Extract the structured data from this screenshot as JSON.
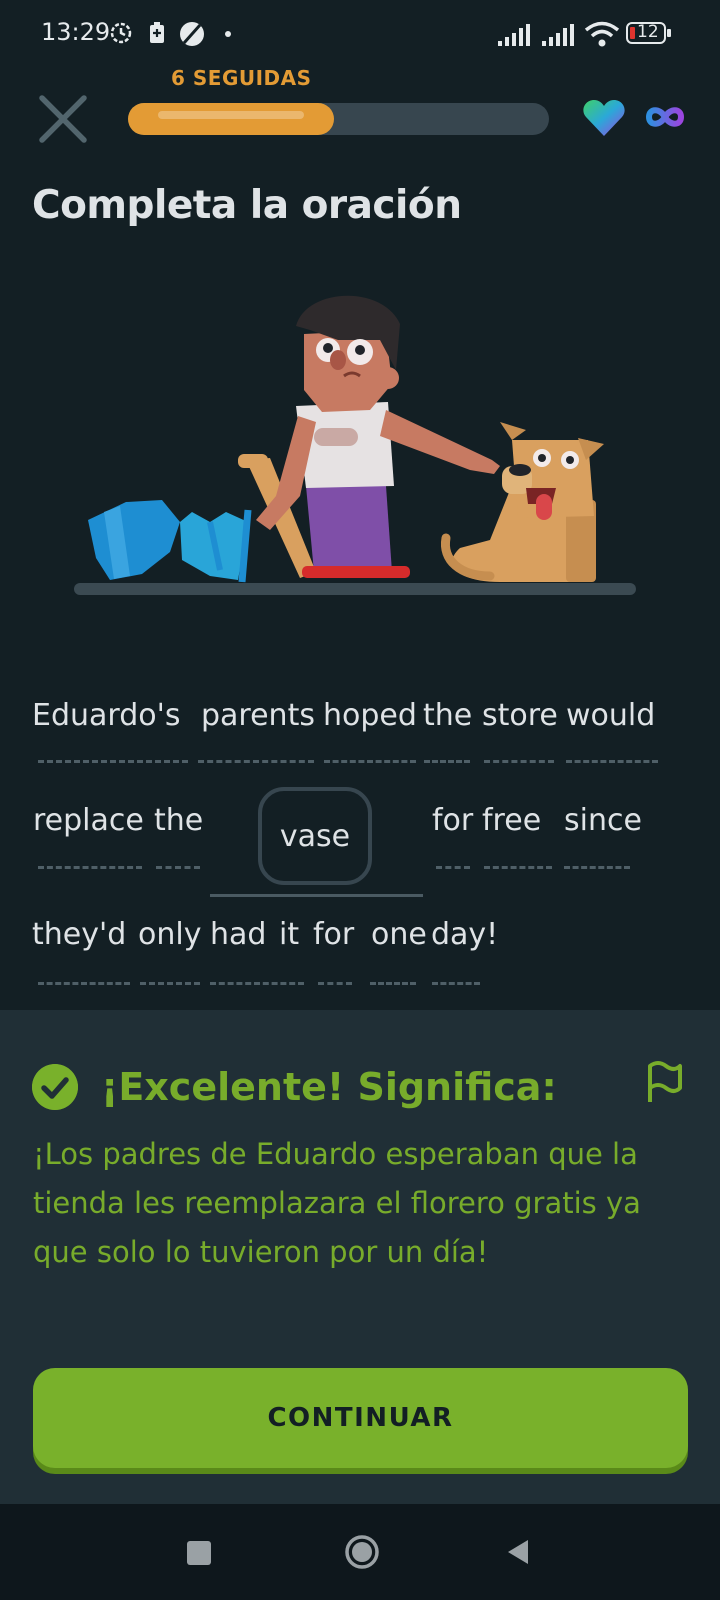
{
  "status_bar": {
    "time": "13:29",
    "battery": "12"
  },
  "header": {
    "streak_label": "6 SEGUIDAS",
    "progress_fraction": 0.49
  },
  "title": "Completa la oración",
  "sentence": {
    "line1": [
      "Eduardo's",
      "parents",
      "hoped",
      "the",
      "store",
      "would"
    ],
    "line2_before": [
      "replace",
      "the"
    ],
    "answer": "vase",
    "line2_after": [
      "for",
      "free",
      "since"
    ],
    "line3": [
      "they'd",
      "only",
      "had",
      "it",
      "for",
      "one",
      "day!"
    ]
  },
  "feedback": {
    "title": "¡Excelente! Significa:",
    "translation": "¡Los padres de Eduardo esperaban que la tienda les reemplazara el florero gratis ya que solo lo tuvieron por un día!"
  },
  "continue_label": "CONTINUAR",
  "colors": {
    "accent_green": "#79b12b",
    "streak_orange": "#e39b35",
    "background": "#131f24",
    "panel": "#202f36"
  }
}
